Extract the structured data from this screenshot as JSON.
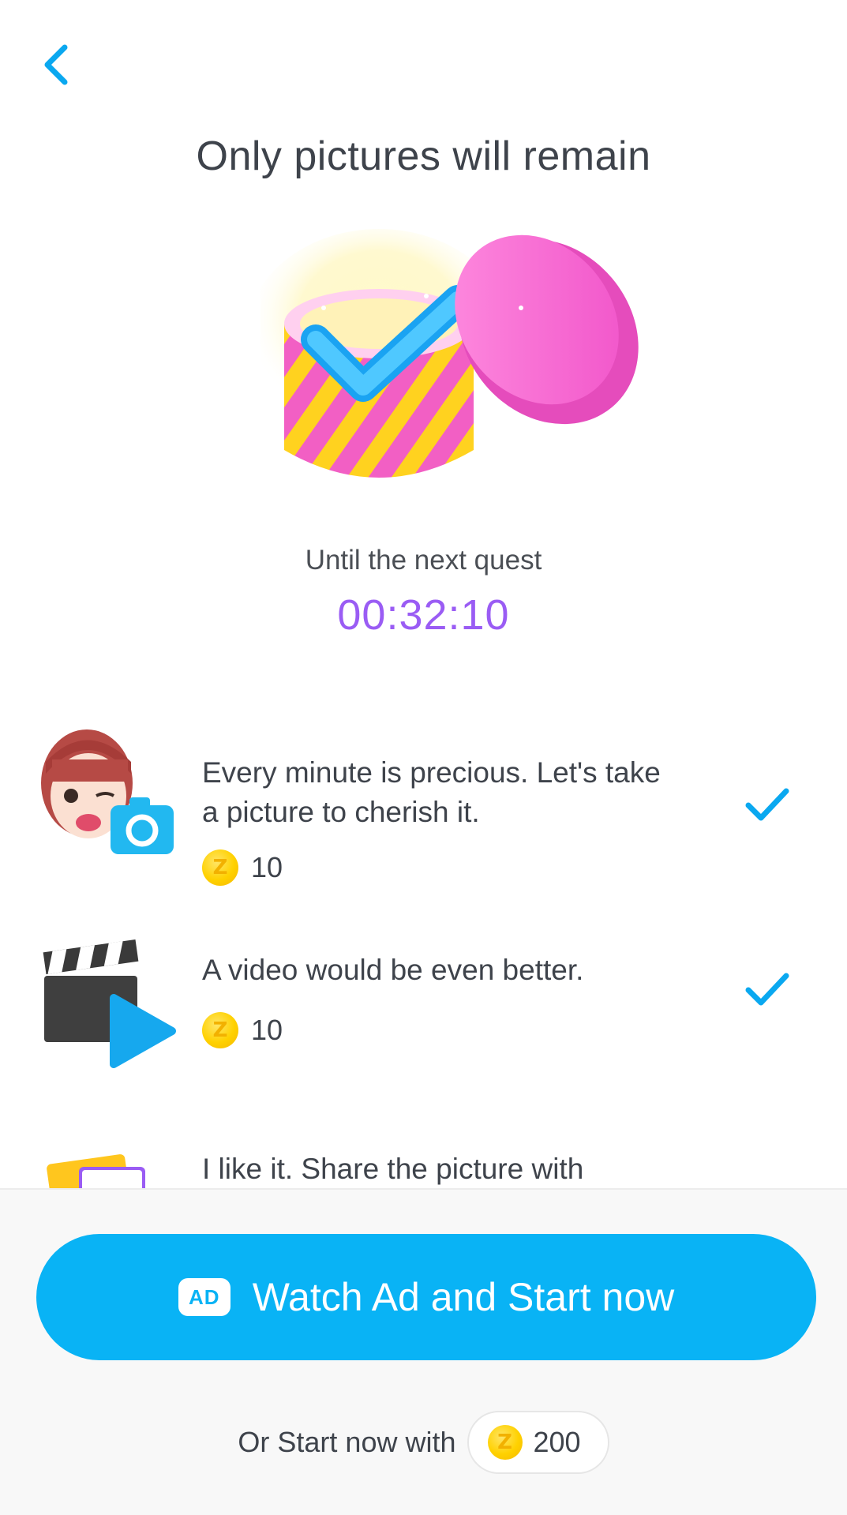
{
  "header": {
    "back_icon": "chevron-left-icon",
    "title": "Only pictures will remain"
  },
  "hero": {
    "icon": "gift-box-checkmark-icon"
  },
  "countdown": {
    "label": "Until the next quest",
    "time": "00:32:10"
  },
  "quests": [
    {
      "text": "Every minute is precious. Let's take a picture to cherish it.",
      "reward": "10",
      "icon": "avatar-camera-icon",
      "completed": true
    },
    {
      "text": "A video would be even better.",
      "reward": "10",
      "icon": "clapperboard-play-icon",
      "completed": true
    },
    {
      "text": "I like it. Share the picture with",
      "icon": "photos-share-icon"
    }
  ],
  "footer": {
    "ad_badge": "AD",
    "watch_label": "Watch Ad and Start now",
    "or_label": "Or Start now with",
    "cost": "200"
  },
  "colors": {
    "accent": "#09b3f5",
    "timer": "#9a5cf4",
    "coin": "#ffd100"
  }
}
